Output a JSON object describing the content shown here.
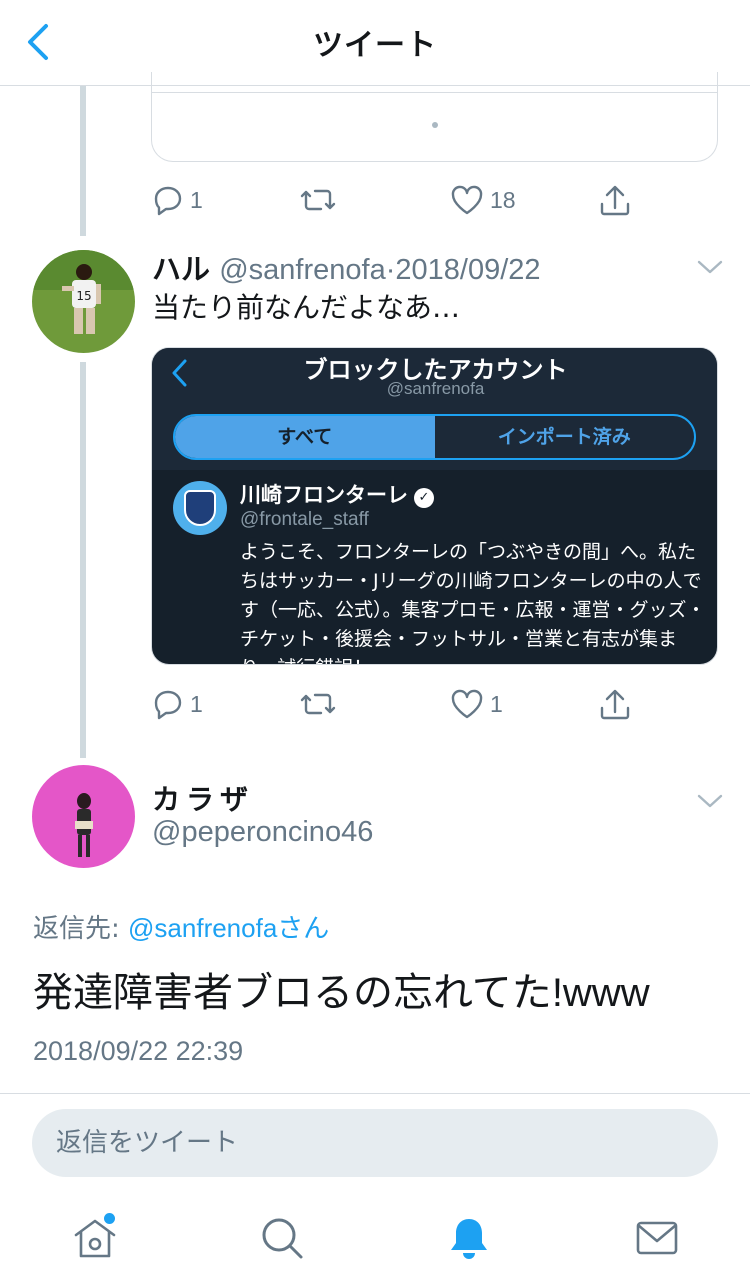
{
  "header": {
    "title": "ツイート"
  },
  "colors": {
    "accent": "#1da1f2",
    "secondary": "#657786",
    "border": "#d8dde2"
  },
  "prev_tweet": {
    "actions": {
      "reply_count": "1",
      "retweet_count": "",
      "like_count": "18"
    }
  },
  "tweet1": {
    "name": "ハル",
    "handle": "@sanfrenofa",
    "separator": "·",
    "date": "2018/09/22",
    "text": "当たり前なんだよなあ…",
    "actions": {
      "reply_count": "1",
      "retweet_count": "",
      "like_count": "1"
    },
    "embedded_screenshot": {
      "title": "ブロックしたアカウント",
      "subtitle": "@sanfrenofa",
      "segments": [
        "すべて",
        "インポート済み"
      ],
      "account_name": "川崎フロンターレ",
      "account_handle": "@frontale_staff",
      "bio": "ようこそ、フロンターレの「つぶやきの間」へ。私たちはサッカー・Jリーグの川崎フロンターレの中の人です（一応、公式）。集客プロモ・広報・運営・グッズ・チケット・後援会・フットサル・営業と有志が集まり、試行錯誤！"
    }
  },
  "focused_tweet": {
    "name": "カラザ",
    "handle": "@peperoncino46",
    "reply_prefix": "返信先: ",
    "reply_mention": "@sanfrenofa",
    "reply_suffix": "さん",
    "text_jp": "発達障害者ブロるの忘れてた",
    "text_latin": "!www",
    "timestamp": "2018/09/22 22:39"
  },
  "reply_placeholder": "返信をツイート",
  "tabbar": {
    "tabs": [
      {
        "icon": "home-icon",
        "active": false
      },
      {
        "icon": "search-icon",
        "active": false
      },
      {
        "icon": "bell-icon",
        "active": true
      },
      {
        "icon": "mail-icon",
        "active": false
      }
    ]
  }
}
